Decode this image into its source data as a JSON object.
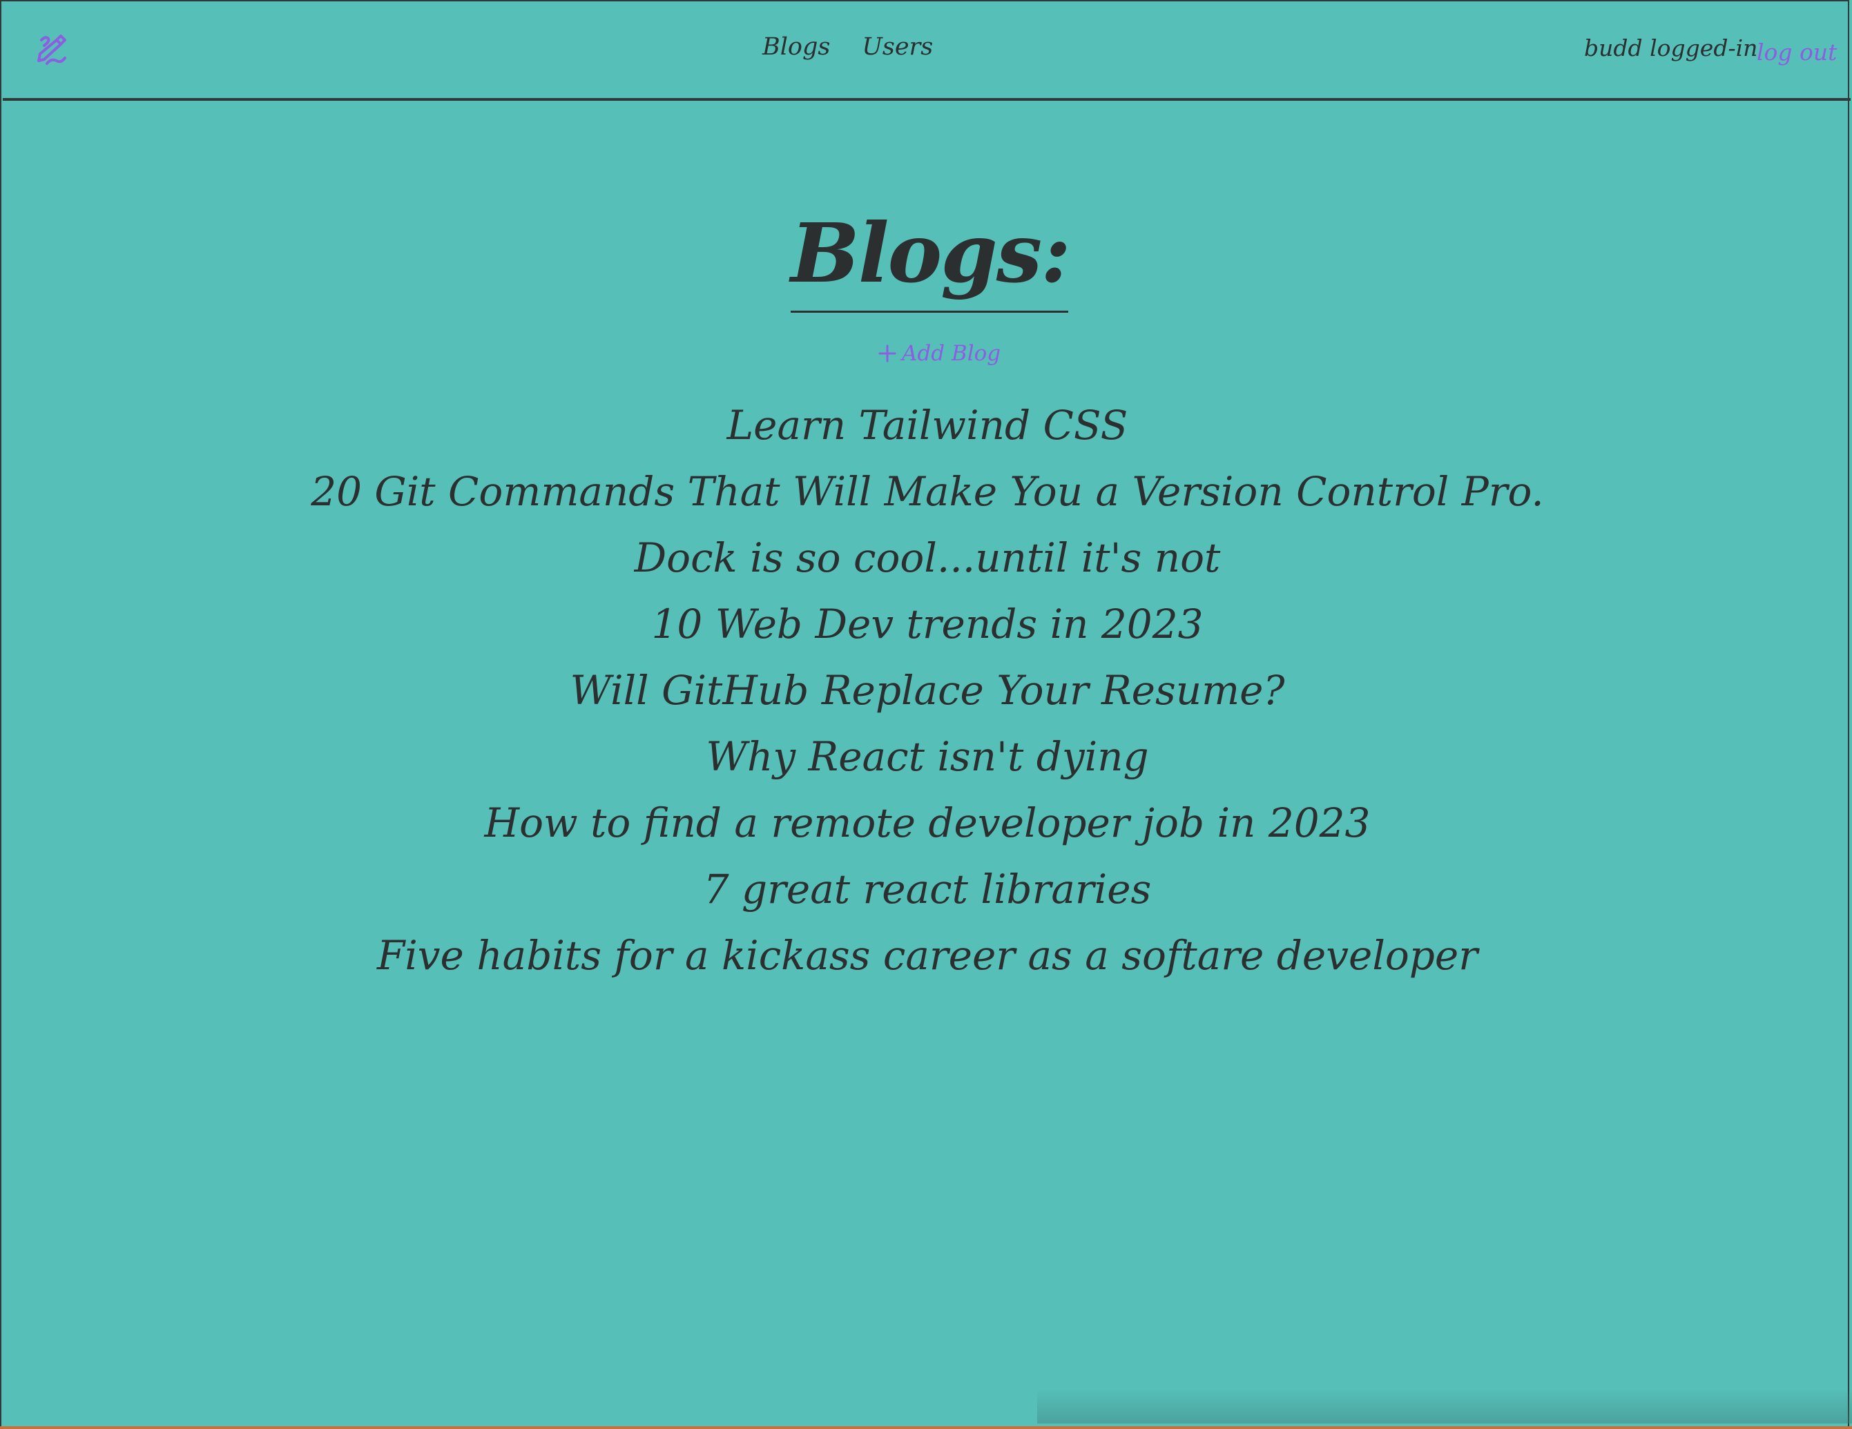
{
  "navbar": {
    "logo_icon": "pencil-squiggle-icon",
    "links": [
      {
        "label": "Blogs"
      },
      {
        "label": "Users"
      }
    ],
    "user_status": "budd logged-in",
    "logout_label": "log out"
  },
  "main": {
    "title": "Blogs:",
    "add_blog_label": "Add Blog",
    "blogs": [
      {
        "title": "Learn Tailwind CSS"
      },
      {
        "title": "20 Git Commands That Will Make You a Version Control Pro."
      },
      {
        "title": "Dock is so cool...until it's not"
      },
      {
        "title": "10 Web Dev trends in 2023"
      },
      {
        "title": "Will GitHub Replace Your Resume?"
      },
      {
        "title": "Why React isn't dying"
      },
      {
        "title": "How to find a remote developer job in 2023"
      },
      {
        "title": "7 great react libraries"
      },
      {
        "title": "Five habits for a kickass career as a softare developer"
      }
    ]
  },
  "colors": {
    "background": "#56bfb8",
    "text": "#2b2f2f",
    "accent": "#8b5fe0"
  }
}
